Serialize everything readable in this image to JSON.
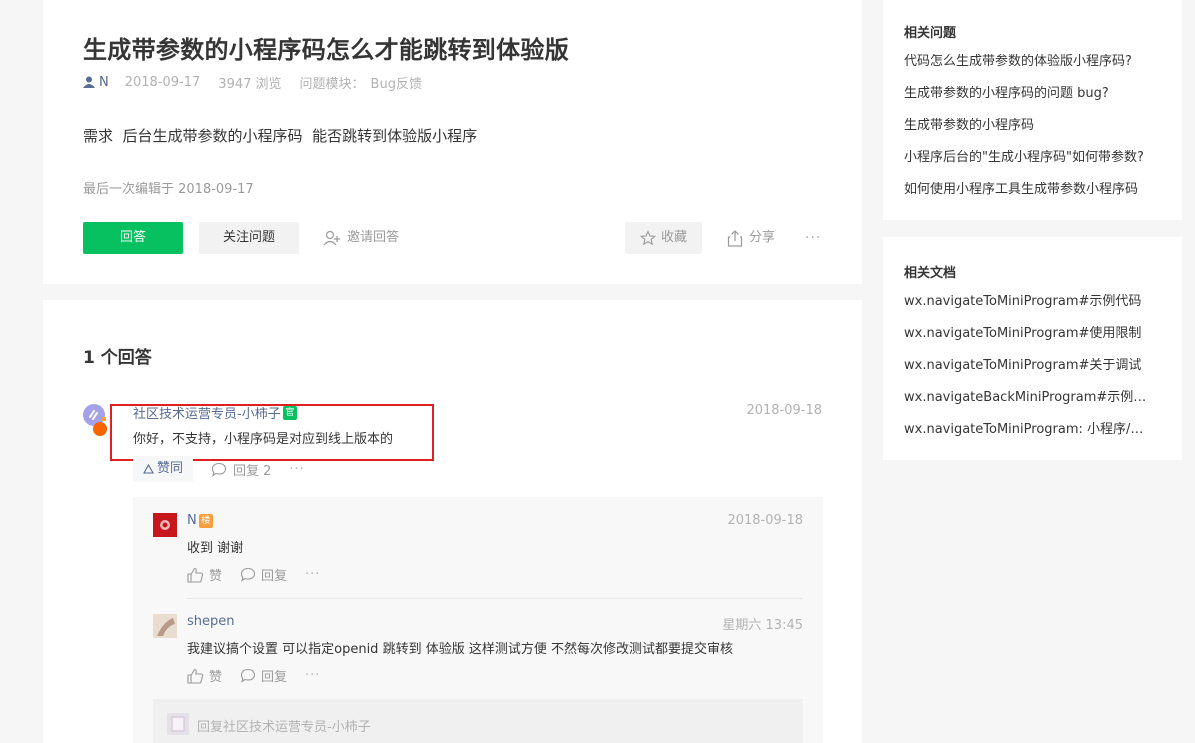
{
  "question": {
    "title": "生成带参数的小程序码怎么才能跳转到体验版",
    "author": "N",
    "date": "2018-09-17",
    "views": "3947 浏览",
    "module_label": "问题模块：",
    "module_value": "Bug反馈",
    "body": "需求  后台生成带参数的小程序码  能否跳转到体验版小程序",
    "last_edited": "最后一次编辑于  2018-09-17",
    "actions": {
      "answer": "回答",
      "follow": "关注问题",
      "invite": "邀请回答",
      "collect": "收藏",
      "share": "分享",
      "more": "···"
    }
  },
  "answers": {
    "count_label": "1 个回答",
    "items": [
      {
        "author": "社区技术运营专员-小柿子",
        "badge": "官",
        "date": "2018-09-18",
        "text": "你好，不支持，小程序码是对应到线上版本的",
        "like_label": "赞同",
        "reply_label": "回复 2",
        "more": "···",
        "comments": [
          {
            "author": "N",
            "badge": "楼",
            "date": "2018-09-18",
            "text": "收到  谢谢",
            "like_label": "赞",
            "reply_label": "回复",
            "more": "···"
          },
          {
            "author": "shepen",
            "date": "星期六 13:45",
            "text": "我建议搞个设置 可以指定openid 跳转到 体验版 这样测试方便 不然每次修改测试都要提交审核",
            "like_label": "赞",
            "reply_label": "回复",
            "more": "···"
          }
        ],
        "reply_placeholder": "回复社区技术运营专员-小柿子"
      }
    ]
  },
  "sidebar": {
    "related_questions": {
      "title": "相关问题",
      "items": [
        "代码怎么生成带参数的体验版小程序码?",
        "生成带参数的小程序码的问题 bug?",
        "生成带参数的小程序码",
        "小程序后台的\"生成小程序码\"如何带参数?",
        "如何使用小程序工具生成带参数小程序码"
      ]
    },
    "related_docs": {
      "title": "相关文档",
      "items": [
        "wx.navigateToMiniProgram#示例代码",
        "wx.navigateToMiniProgram#使用限制",
        "wx.navigateToMiniProgram#关于调试",
        "wx.navigateBackMiniProgram#示例代码",
        "wx.navigateToMiniProgram: 小程序/小游戏"
      ]
    }
  },
  "colors": {
    "accent_green": "#07c160",
    "link_blue": "#576b95",
    "highlight_red": "#e02020",
    "badge_orange": "#fa9d3b"
  }
}
